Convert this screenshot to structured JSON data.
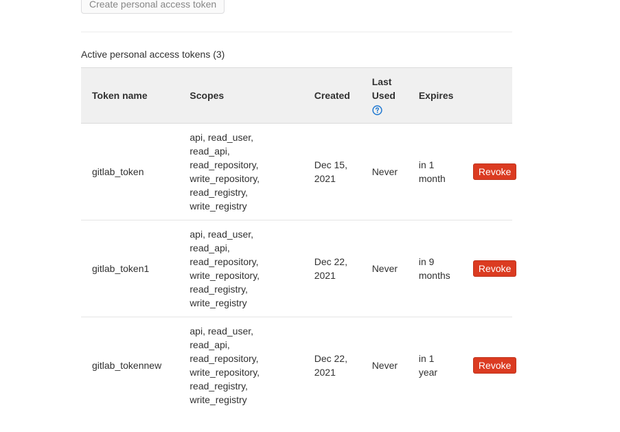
{
  "create_button": {
    "label": "Create personal access token"
  },
  "section": {
    "title": "Active personal access tokens (3)"
  },
  "table": {
    "headers": {
      "token_name": "Token name",
      "scopes": "Scopes",
      "created": "Created",
      "last_used_line1": "Last",
      "last_used_line2": "Used",
      "expires": "Expires"
    },
    "help_icon": "question-circle-icon",
    "rows": [
      {
        "name": "gitlab_token",
        "scopes": [
          "api, read_user,",
          "read_api,",
          "read_repository,",
          "write_repository,",
          "read_registry,",
          "write_registry"
        ],
        "created_line1": "Dec 15,",
        "created_line2": "2021",
        "last_used": "Never",
        "expires_line1": "in 1",
        "expires_line2": "month",
        "action": "Revoke"
      },
      {
        "name": "gitlab_token1",
        "scopes": [
          "api, read_user,",
          "read_api,",
          "read_repository,",
          "write_repository,",
          "read_registry,",
          "write_registry"
        ],
        "created_line1": "Dec 22,",
        "created_line2": "2021",
        "last_used": "Never",
        "expires_line1": "in 9",
        "expires_line2": "months",
        "action": "Revoke"
      },
      {
        "name": "gitlab_tokennew",
        "scopes": [
          "api, read_user,",
          "read_api,",
          "read_repository,",
          "write_repository,",
          "read_registry,",
          "write_registry"
        ],
        "created_line1": "Dec 22,",
        "created_line2": "2021",
        "last_used": "Never",
        "expires_line1": "in 1",
        "expires_line2": "year",
        "action": "Revoke"
      }
    ]
  },
  "colors": {
    "revoke": "#db3b21",
    "header_bg": "#f0f0f0",
    "help_icon": "#1f78d1"
  }
}
